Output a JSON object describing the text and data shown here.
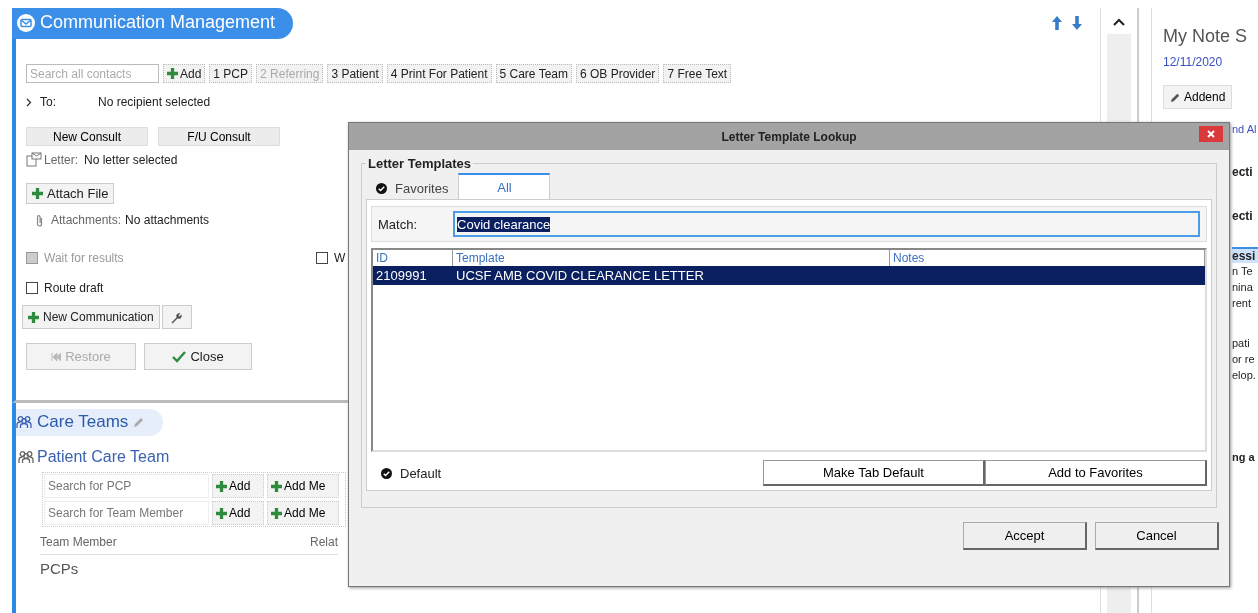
{
  "comm": {
    "title": "Communication Management",
    "toolbar": {
      "search_placeholder": "Search all contacts",
      "add": "Add",
      "buttons": [
        {
          "label": "1 PCP",
          "disabled": false
        },
        {
          "label": "2 Referring",
          "disabled": true
        },
        {
          "label": "3 Patient",
          "disabled": false
        },
        {
          "label": "4 Print For Patient",
          "disabled": false
        },
        {
          "label": "5 Care Team",
          "disabled": false
        },
        {
          "label": "6 OB Provider",
          "disabled": false
        },
        {
          "label": "7 Free Text",
          "disabled": false
        }
      ]
    },
    "to": {
      "label": "To:",
      "value": "No recipient selected"
    },
    "consult_buttons": [
      "New Consult",
      "F/U Consult"
    ],
    "letter": {
      "label": "Letter:",
      "value": "No letter selected"
    },
    "attach_button": "Attach File",
    "attachments": {
      "label": "Attachments:",
      "value": "No attachments"
    },
    "checkbox_rows": [
      [
        {
          "label": "Wait for results",
          "checked": false,
          "disabled": true
        },
        {
          "label": "W",
          "checked": false,
          "disabled": false
        }
      ],
      [
        {
          "label": "Route draft",
          "checked": false,
          "disabled": false
        }
      ]
    ],
    "new_button": "New Communication",
    "restore": {
      "label": "Restore",
      "disabled": true
    },
    "close": "Close"
  },
  "care_teams": {
    "title": "Care Teams",
    "subtitle": "Patient Care Team",
    "search_rows": [
      {
        "placeholder": "Search for PCP",
        "add": "Add",
        "add_me": "Add Me"
      },
      {
        "placeholder": "Search for Team Member",
        "add": "Add",
        "add_me": "Add Me"
      }
    ],
    "columns": [
      "Team Member",
      "Relat"
    ],
    "group": "PCPs"
  },
  "right_panel": {
    "title": "My Note S",
    "date": "12/11/2020",
    "addend": "Addend",
    "fragments": [
      {
        "kind": "link",
        "text": "nd Al"
      },
      {
        "kind": "heading",
        "text": "ecti"
      },
      {
        "kind": "heading",
        "text": "ecti"
      },
      {
        "kind": "highlight",
        "text": "essi"
      },
      {
        "kind": "text",
        "text": "n Te"
      },
      {
        "kind": "text",
        "text": "nina"
      },
      {
        "kind": "text",
        "text": "rent"
      },
      {
        "kind": "gap",
        "text": "pati"
      },
      {
        "kind": "text",
        "text": "or re"
      },
      {
        "kind": "text",
        "text": "elop."
      },
      {
        "kind": "bottom",
        "text": "ng a"
      }
    ]
  },
  "dialog": {
    "title": "Letter Template Lookup",
    "group": "Letter Templates",
    "tabs": [
      {
        "label": "Favorites",
        "selected": false,
        "favorite": true
      },
      {
        "label": "All",
        "selected": true,
        "favorite": false
      }
    ],
    "match": {
      "label": "Match:",
      "value": "Covid clearance"
    },
    "table": {
      "columns": [
        "ID",
        "Template",
        "Notes"
      ],
      "rows": [
        {
          "cells": [
            "2109991",
            "UCSF AMB COVID CLEARANCE LETTER",
            ""
          ],
          "selected": true
        }
      ]
    },
    "default": {
      "label": "Default",
      "checked": true
    },
    "buttons": [
      "Make Tab Default",
      "Add to Favorites"
    ],
    "footer_buttons": [
      "Accept",
      "Cancel"
    ]
  }
}
